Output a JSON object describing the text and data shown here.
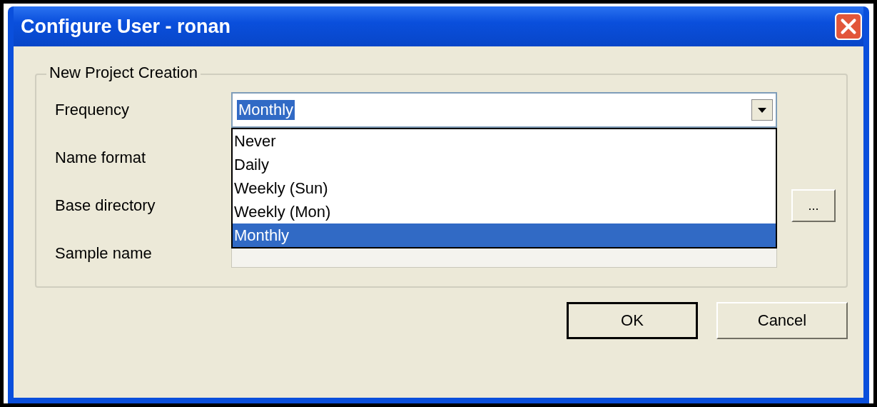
{
  "window": {
    "title": "Configure User - ronan"
  },
  "group": {
    "title": "New Project Creation"
  },
  "fields": [
    {
      "label": "Frequency",
      "kind": "combo",
      "value": "Monthly",
      "expanded": true
    },
    {
      "label": "Name format",
      "kind": "text"
    },
    {
      "label": "Base directory",
      "kind": "browse",
      "button": "..."
    },
    {
      "label": "Sample name",
      "kind": "text"
    }
  ],
  "options": [
    {
      "label": "Never",
      "selected": false
    },
    {
      "label": "Daily",
      "selected": false
    },
    {
      "label": "Weekly (Sun)",
      "selected": false
    },
    {
      "label": "Weekly (Mon)",
      "selected": false
    },
    {
      "label": "Monthly",
      "selected": true
    }
  ],
  "buttons": [
    {
      "label": "OK",
      "default": true
    },
    {
      "label": "Cancel",
      "default": false
    }
  ]
}
